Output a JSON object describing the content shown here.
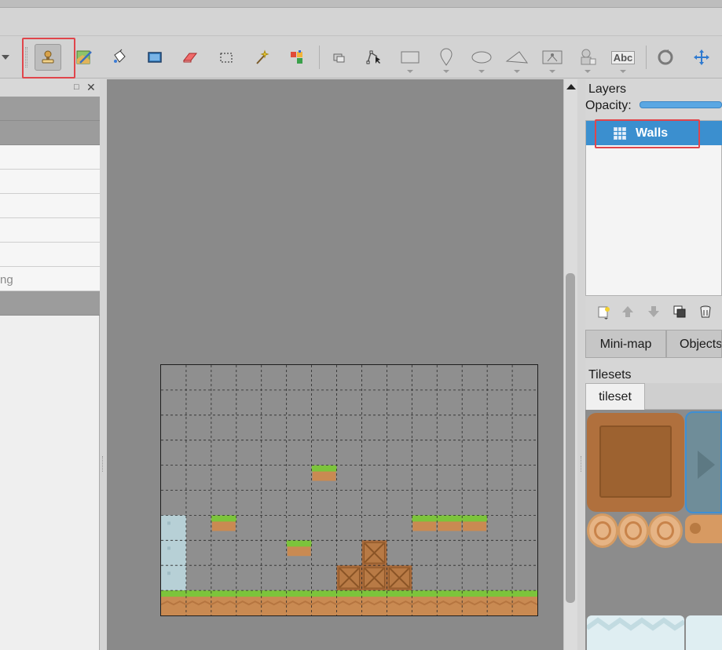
{
  "toolbar": {
    "tools": [
      {
        "name": "stamp-brush-icon",
        "selected": true
      },
      {
        "name": "terrain-brush-icon"
      },
      {
        "name": "bucket-fill-icon"
      },
      {
        "name": "shape-fill-icon"
      },
      {
        "name": "eraser-icon"
      },
      {
        "name": "rect-select-icon"
      },
      {
        "name": "magic-wand-icon"
      },
      {
        "name": "select-same-tile-icon"
      },
      {
        "name": "select-objects-icon"
      },
      {
        "name": "edit-polygons-icon"
      },
      {
        "name": "insert-rectangle-icon"
      },
      {
        "name": "insert-point-icon"
      },
      {
        "name": "insert-ellipse-icon"
      },
      {
        "name": "insert-polygon-icon"
      },
      {
        "name": "insert-tile-icon"
      },
      {
        "name": "insert-template-icon"
      },
      {
        "name": "insert-text-icon"
      },
      {
        "name": "rotate-icon"
      },
      {
        "name": "move-icon"
      }
    ],
    "text_tool_label": "Abc"
  },
  "properties_panel": {
    "truncated_value": "ng"
  },
  "layers_panel": {
    "title": "Layers",
    "opacity_label": "Opacity:",
    "layers": [
      {
        "name": "Walls",
        "selected": true,
        "type_icon": "tile-layer-grid-icon"
      }
    ]
  },
  "bottom_tabs": {
    "minimap_label": "Mini-map",
    "objects_label": "Objects"
  },
  "tilesets_panel": {
    "title": "Tilesets",
    "tab_label": "tileset"
  },
  "map": {
    "columns": 15,
    "rows": 10,
    "tiles": [
      {
        "type": "grass",
        "col": 6,
        "row": 4
      },
      {
        "type": "ice",
        "col": 0,
        "row": 6
      },
      {
        "type": "grass",
        "col": 2,
        "row": 6
      },
      {
        "type": "grass",
        "col": 10,
        "row": 6
      },
      {
        "type": "grass",
        "col": 11,
        "row": 6
      },
      {
        "type": "grass",
        "col": 12,
        "row": 6
      },
      {
        "type": "ice",
        "col": 0,
        "row": 7
      },
      {
        "type": "grass",
        "col": 5,
        "row": 7
      },
      {
        "type": "crate",
        "col": 8,
        "row": 7
      },
      {
        "type": "ice",
        "col": 0,
        "row": 8
      },
      {
        "type": "crate",
        "col": 7,
        "row": 8
      },
      {
        "type": "crate",
        "col": 8,
        "row": 8
      },
      {
        "type": "crate",
        "col": 9,
        "row": 8
      },
      {
        "type": "ground",
        "col": 0,
        "row": 9
      },
      {
        "type": "ground",
        "col": 1,
        "row": 9
      },
      {
        "type": "ground",
        "col": 2,
        "row": 9
      },
      {
        "type": "ground",
        "col": 3,
        "row": 9
      },
      {
        "type": "ground",
        "col": 4,
        "row": 9
      },
      {
        "type": "ground",
        "col": 5,
        "row": 9
      },
      {
        "type": "ground",
        "col": 6,
        "row": 9
      },
      {
        "type": "ground",
        "col": 7,
        "row": 9
      },
      {
        "type": "ground",
        "col": 8,
        "row": 9
      },
      {
        "type": "ground",
        "col": 9,
        "row": 9
      },
      {
        "type": "ground",
        "col": 10,
        "row": 9
      },
      {
        "type": "ground",
        "col": 11,
        "row": 9
      },
      {
        "type": "ground",
        "col": 12,
        "row": 9
      },
      {
        "type": "ground",
        "col": 13,
        "row": 9
      },
      {
        "type": "ground",
        "col": 14,
        "row": 9
      }
    ]
  },
  "colors": {
    "highlight": "#e0454b",
    "selection_blue": "#3b8fcf",
    "grass": "#7cc43b",
    "dirt": "#c98a52",
    "crate": "#a86a3a",
    "ice": "#b7d0d6"
  }
}
